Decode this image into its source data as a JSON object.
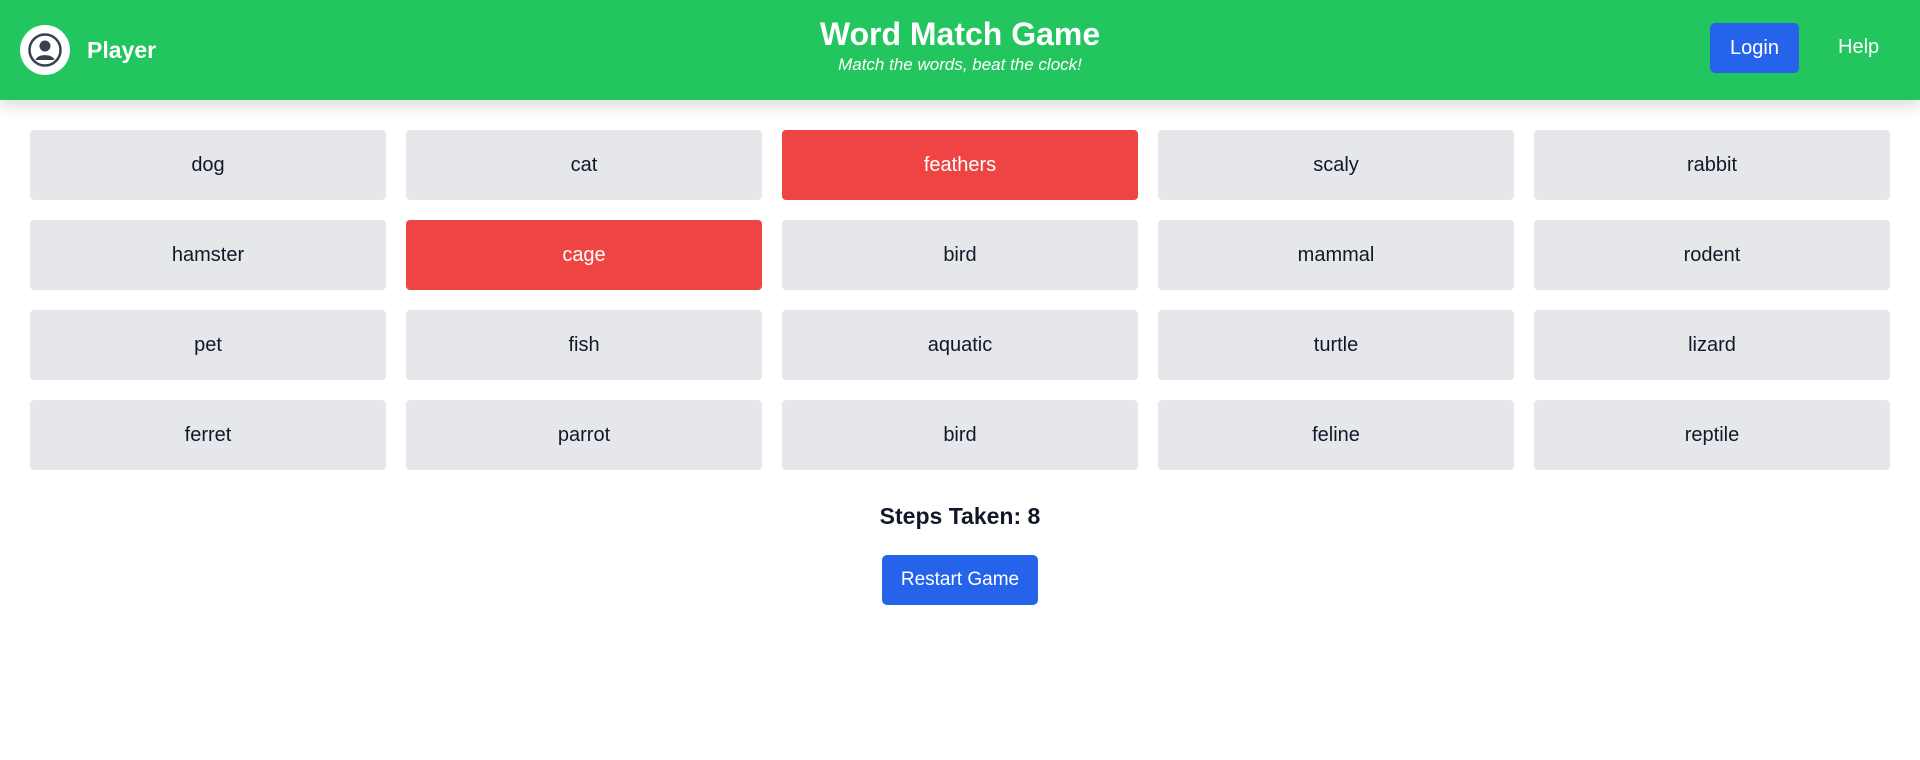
{
  "header": {
    "player_name": "Player",
    "avatar_icon": "user-circle-icon",
    "title": "Word Match Game",
    "subtitle": "Match the words, beat the clock!",
    "login_label": "Login",
    "help_label": "Help",
    "accent_color": "#22c55e"
  },
  "board": {
    "selected_color": "#ef4444",
    "tiles": [
      {
        "word": "dog",
        "selected": false
      },
      {
        "word": "cat",
        "selected": false
      },
      {
        "word": "feathers",
        "selected": true
      },
      {
        "word": "scaly",
        "selected": false
      },
      {
        "word": "rabbit",
        "selected": false
      },
      {
        "word": "hamster",
        "selected": false
      },
      {
        "word": "cage",
        "selected": true
      },
      {
        "word": "bird",
        "selected": false
      },
      {
        "word": "mammal",
        "selected": false
      },
      {
        "word": "rodent",
        "selected": false
      },
      {
        "word": "pet",
        "selected": false
      },
      {
        "word": "fish",
        "selected": false
      },
      {
        "word": "aquatic",
        "selected": false
      },
      {
        "word": "turtle",
        "selected": false
      },
      {
        "word": "lizard",
        "selected": false
      },
      {
        "word": "ferret",
        "selected": false
      },
      {
        "word": "parrot",
        "selected": false
      },
      {
        "word": "bird",
        "selected": false
      },
      {
        "word": "feline",
        "selected": false
      },
      {
        "word": "reptile",
        "selected": false
      }
    ]
  },
  "status": {
    "steps_text": "Steps Taken: 8"
  },
  "controls": {
    "restart_label": "Restart Game",
    "button_color": "#2563eb"
  }
}
